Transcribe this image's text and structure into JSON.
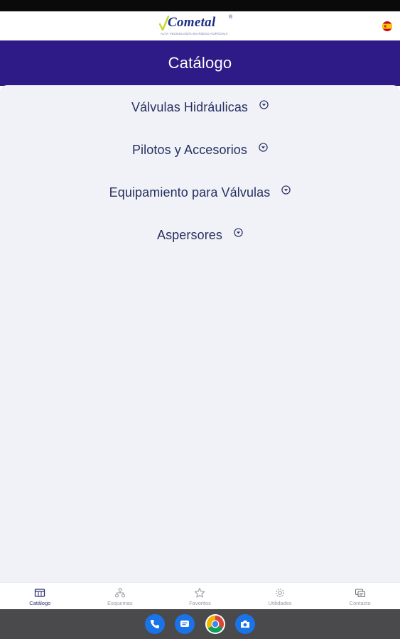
{
  "header": {
    "logo_text": "Cometal",
    "logo_registered": "®",
    "logo_tagline": "ALTA TECNOLOGÍA EN RIEGO AGRÍCOLA",
    "language_flag": "flag-spain-icon"
  },
  "title_bar": {
    "title": "Catálogo"
  },
  "catalog": {
    "items": [
      {
        "label": "Válvulas Hidráulicas",
        "icon": "chevron-down-circle-icon"
      },
      {
        "label": "Pilotos y Accesorios",
        "icon": "chevron-down-circle-icon"
      },
      {
        "label": "Equipamiento para Válvulas",
        "icon": "chevron-down-circle-icon"
      },
      {
        "label": "Aspersores",
        "icon": "chevron-down-circle-icon"
      }
    ]
  },
  "bottom_nav": {
    "items": [
      {
        "label": "Catálogo",
        "icon": "catalog-icon",
        "active": true
      },
      {
        "label": "Esquemas",
        "icon": "schemes-icon",
        "active": false
      },
      {
        "label": "Favoritos",
        "icon": "star-icon",
        "active": false
      },
      {
        "label": "Utilidades",
        "icon": "gear-icon",
        "active": false
      },
      {
        "label": "Contacto",
        "icon": "contact-icon",
        "active": false
      }
    ]
  },
  "dock": {
    "apps": [
      "phone-app-icon",
      "messages-app-icon",
      "chrome-app-icon",
      "camera-app-icon"
    ]
  },
  "colors": {
    "title_bar": "#2e1b87",
    "content_bg": "#f1f2f8",
    "item_text": "#26305f",
    "logo_blue": "#1b2e86",
    "logo_check": "#c8d62c"
  }
}
